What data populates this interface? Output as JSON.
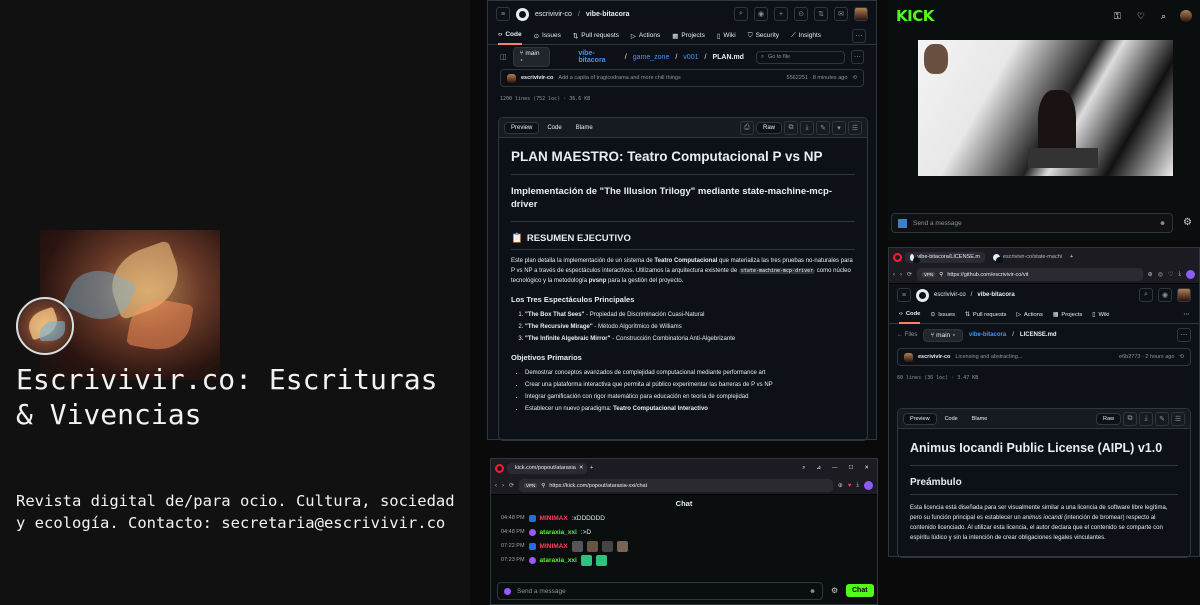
{
  "left": {
    "title": "Escrivivir.co: Escrituras & Vivencias",
    "tagline": "Revista digital de/para ocio. Cultura, sociedad y ecología. Contacto: secretaria@escrivivir.co"
  },
  "github_top": {
    "owner": "escrivivir-co",
    "repo": "vibe-bitacora",
    "tabs": [
      "Code",
      "Issues",
      "Pull requests",
      "Actions",
      "Projects",
      "Wiki",
      "Security",
      "Insights"
    ],
    "branch": "main",
    "path_repo": "vibe-bitacora",
    "path_dir1": "game_zone",
    "path_dir2": "v001",
    "path_file": "PLAN.md",
    "search_placeholder": "Go to file",
    "commit_author": "escrivivir-co",
    "commit_msg": "Add a capita of tragicodrama and more chill things",
    "commit_meta": "5562251 · 8 minutes ago",
    "lines_info": "1200 lines (752 loc) · 36.6 KB",
    "view_tabs": [
      "Preview",
      "Code",
      "Blame"
    ],
    "raw_label": "Raw",
    "doc": {
      "h1": "PLAN MAESTRO: Teatro Computacional P vs NP",
      "h2": "Implementación de \"The Illusion Trilogy\" mediante state-machine-mcp-driver",
      "summary_emoji": "📋",
      "summary_title": "RESUMEN EJECUTIVO",
      "p_a": "Este plan detalla la implementación de un sistema de ",
      "p_b": "Teatro Computacional",
      "p_c": " que materializa las tres pruebas no-naturales para P vs NP a través de espectáculos interactivos. Utilizamos la arquitectura existente de ",
      "p_code": "state-machine-mcp-driver",
      "p_d": " como núcleo tecnológico y la metodología ",
      "p_e": "pvsnp",
      "p_f": " para la gestión del proyecto.",
      "h3a": "Los Tres Espectáculos Principales",
      "shows": [
        {
          "name": "\"The Box That Sees\"",
          "desc": " - Propiedad de Discriminación Cuasi-Natural"
        },
        {
          "name": "\"The Recursive Mirage\"",
          "desc": " - Método Algorítmico de Williams"
        },
        {
          "name": "\"The Infinite Algebraic Mirror\"",
          "desc": " - Construcción Combinatoria Anti-Algebrizante"
        }
      ],
      "h3b": "Objetivos Primarios",
      "goals": [
        "Demostrar conceptos avanzados de complejidad computacional mediante performance art",
        "Crear una plataforma interactiva que permita al público experimentar las barreras de P vs NP",
        "Integrar gamificación con rigor matemático para educación en teoría de complejidad"
      ],
      "goal4_a": "Establecer un nuevo paradigma: ",
      "goal4_b": "Teatro Computacional Interactivo"
    }
  },
  "kick_top": {
    "logo": "KICK",
    "send_placeholder": "Send a message"
  },
  "browser_right": {
    "tab1": "vibe-bitacora/LICENSE.m",
    "tab2": "escrivivir-co/state-machi",
    "url": "https://github.com/escrivivir-co/vit",
    "vpn": "VPN",
    "owner": "escrivivir-co",
    "repo": "vibe-bitacora",
    "tabs": [
      "Code",
      "Issues",
      "Pull requests",
      "Actions",
      "Projects",
      "Wiki"
    ],
    "files_label": "Files",
    "branch": "main",
    "path_repo": "vibe-bitacora",
    "path_file": "LICENSE.md",
    "commit_author": "escrivivir-co",
    "commit_msg": "Licensing and abstracting...",
    "commit_meta": "e6b2773 · 2 hours ago",
    "lines_info": "60 lines (36 loc) · 3.47 KB",
    "view_tabs": [
      "Preview",
      "Code",
      "Blame"
    ],
    "raw_label": "Raw",
    "h1": "Animus Iocandi Public License (AIPL) v1.0",
    "h2": "Preámbulo",
    "p_a": "Esta licencia está diseñada para ser visualmente similar a una licencia de software libre legítima, pero su función principal es establecer un ",
    "p_b": "animus iocandi",
    "p_c": " (intención de bromear) respecto al contenido licenciado. Al utilizar esta licencia, el autor declara que el contenido se comparte con espíritu lúdico y sin la intención de crear obligaciones legales vinculantes."
  },
  "kick_chat": {
    "tab_url": "kick.com/popout/ataraxia",
    "url": "https://kick.com/popout/ataraxia-xxi/chat",
    "vpn": "VPN",
    "header": "Chat",
    "messages": [
      {
        "time": "04:48 PM",
        "user": "MINIMAX",
        "text": ":xDDDDDD",
        "color": "#ff3b5c"
      },
      {
        "time": "04:48 PM",
        "user": "ataraxia_xxi",
        "text": ":>D",
        "color": "#53fc18"
      },
      {
        "time": "07:22 PM",
        "user": "MINIMAX",
        "text": "",
        "color": "#ff3b5c"
      },
      {
        "time": "07:23 PM",
        "user": "ataraxia_xxi",
        "text": "",
        "color": "#53fc18"
      }
    ],
    "send_placeholder": "Send a message",
    "chat_button": "Chat"
  }
}
